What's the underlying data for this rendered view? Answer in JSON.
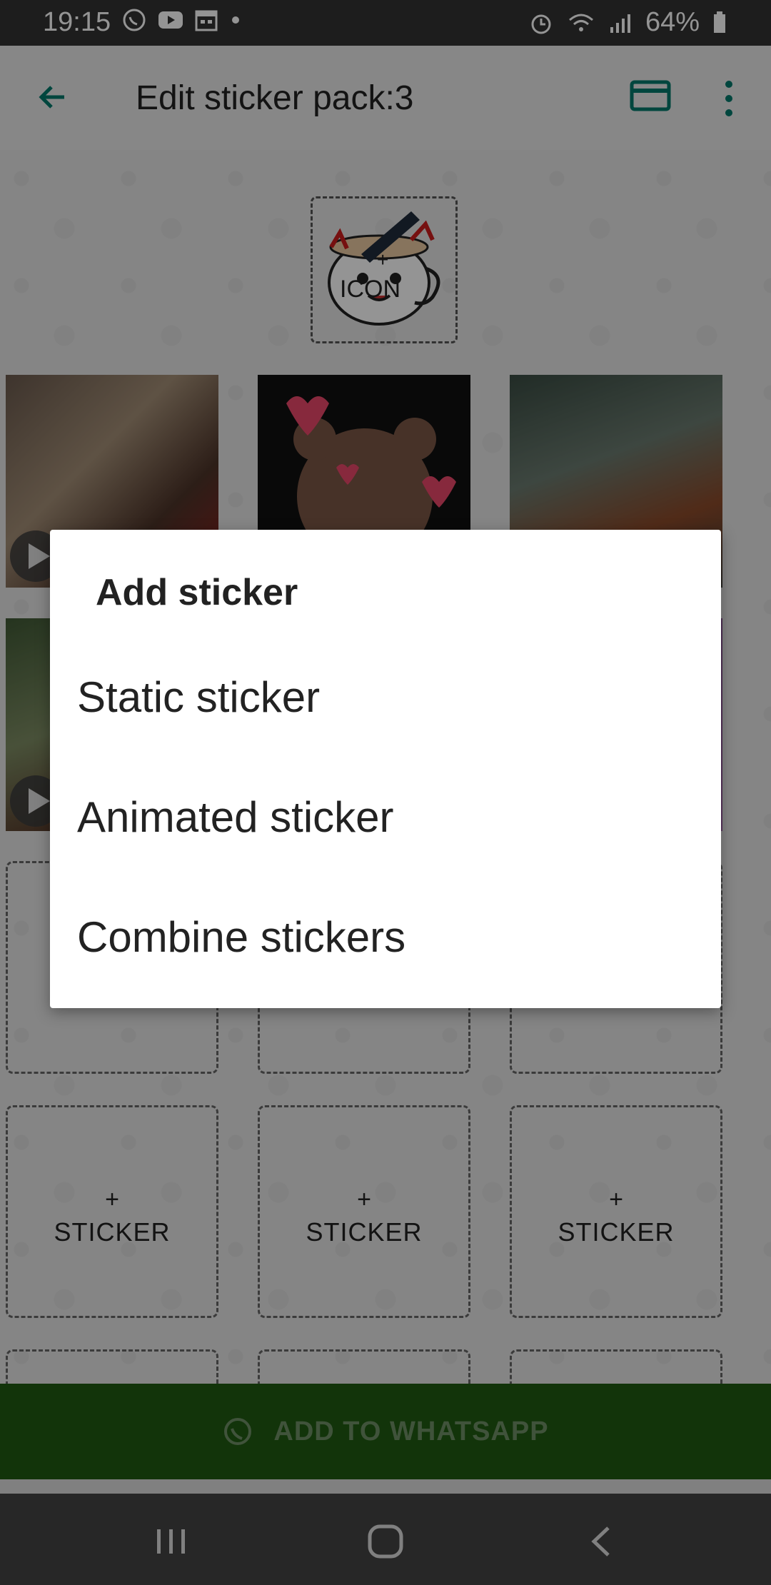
{
  "status_bar": {
    "time": "19:15",
    "battery": "64%",
    "left_icons": [
      "whatsapp-icon",
      "youtube-icon",
      "calendar-icon",
      "dot-icon"
    ],
    "right_icons": [
      "alarm-icon",
      "wifi-icon",
      "signal-icon",
      "battery-icon"
    ]
  },
  "app_bar": {
    "title": "Edit sticker pack:3"
  },
  "pack_icon": {
    "plus": "+",
    "label": "ICON"
  },
  "empty_sticker": {
    "plus": "+",
    "label": "STICKER"
  },
  "add_button": {
    "label": "ADD TO WHATSAPP"
  },
  "dialog": {
    "title": "Add sticker",
    "options": [
      "Static sticker",
      "Animated sticker",
      "Combine stickers"
    ]
  },
  "colors": {
    "accent": "#00796b",
    "button_green": "#2e7d1d"
  }
}
